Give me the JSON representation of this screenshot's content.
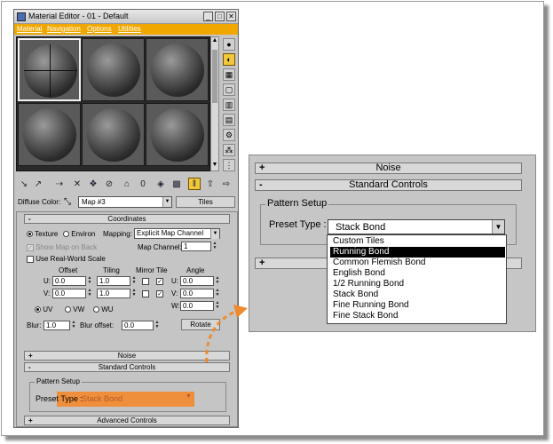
{
  "window": {
    "title": "Material Editor - 01 - Default",
    "buttons": [
      "_",
      "□",
      "✕"
    ]
  },
  "menubar": [
    "Material",
    "Navigation",
    "Options",
    "Utilities"
  ],
  "diffuse": {
    "label": "Diffuse Color:",
    "map_name": "Map #3",
    "map_type_button": "Tiles"
  },
  "coordinates": {
    "title": "Coordinates",
    "texture_label": "Texture",
    "environ_label": "Environ",
    "mapping_label": "Mapping:",
    "mapping_value": "Explicit Map Channel",
    "show_map_on_back": "Show Map on Back",
    "map_channel_label": "Map Channel:",
    "map_channel_value": "1",
    "real_world_scale": "Use Real-World Scale",
    "col_offset": "Offset",
    "col_tiling": "Tiling",
    "col_mirror_tile": "Mirror Tile",
    "col_angle": "Angle",
    "u_label": "U:",
    "v_label": "V:",
    "w_label": "W:",
    "u_offset": "0.0",
    "v_offset": "0.0",
    "u_tiling": "1.0",
    "v_tiling": "1.0",
    "u_angle": "0.0",
    "v_angle": "0.0",
    "w_angle": "0.0",
    "uv_label": "UV",
    "vw_label": "VW",
    "wu_label": "WU",
    "blur_label": "Blur:",
    "blur_value": "1.0",
    "blur_offset_label": "Blur offset:",
    "blur_offset_value": "0.0",
    "rotate_button": "Rotate"
  },
  "rollouts": {
    "noise": "Noise",
    "standard_controls": "Standard Controls",
    "advanced_controls": "Advanced Controls",
    "plus": "+",
    "minus": "-"
  },
  "pattern_setup": {
    "group_title": "Pattern Setup",
    "preset_label": "Preset Type :",
    "preset_value": "Stack Bond"
  },
  "zoom": {
    "noise": "Noise",
    "standard_controls": "Standard Controls",
    "group_title": "Pattern Setup",
    "preset_label": "Preset Type :",
    "preset_value": "Stack Bond",
    "options": [
      "Custom Tiles",
      "Running Bond",
      "Common Flemish Bond",
      "English Bond",
      "1/2 Running Bond",
      "Stack Bond",
      "Fine Running Bond",
      "Fine Stack Bond"
    ],
    "selected_index": 1
  },
  "colors": {
    "menubar": "#f0a800",
    "highlight": "#f28a30",
    "arrow": "#f08a30",
    "selected_tool": "#f3c73a"
  }
}
